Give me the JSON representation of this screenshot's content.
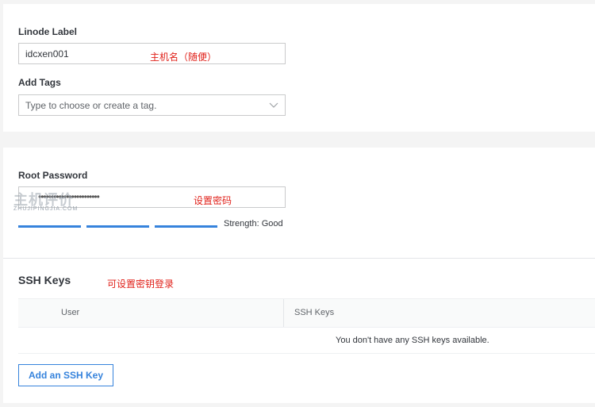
{
  "linode_label": {
    "label": "Linode Label",
    "value": "idcxen001",
    "annotation": "主机名（随便）"
  },
  "tags": {
    "label": "Add Tags",
    "placeholder": "Type to choose or create a tag.",
    "dropdown_icon": "chevron-down-icon"
  },
  "root_password": {
    "label": "Root Password",
    "masked_value": "••••••••••••••••••••••••",
    "annotation": "设置密码",
    "strength_text": "Strength: Good",
    "strength_segments": 3,
    "strength_color": "#3683dc"
  },
  "ssh_keys": {
    "title": "SSH Keys",
    "annotation": "可设置密钥登录",
    "columns": [
      "User",
      "SSH Keys"
    ],
    "empty_message": "You don't have any SSH keys available.",
    "add_button": "Add an SSH Key"
  },
  "watermark": {
    "text": "主机评价",
    "subtext": "ZHUJIPINGJIA.COM"
  },
  "colors": {
    "accent": "#3683dc",
    "annotation_red": "#e0211a"
  }
}
